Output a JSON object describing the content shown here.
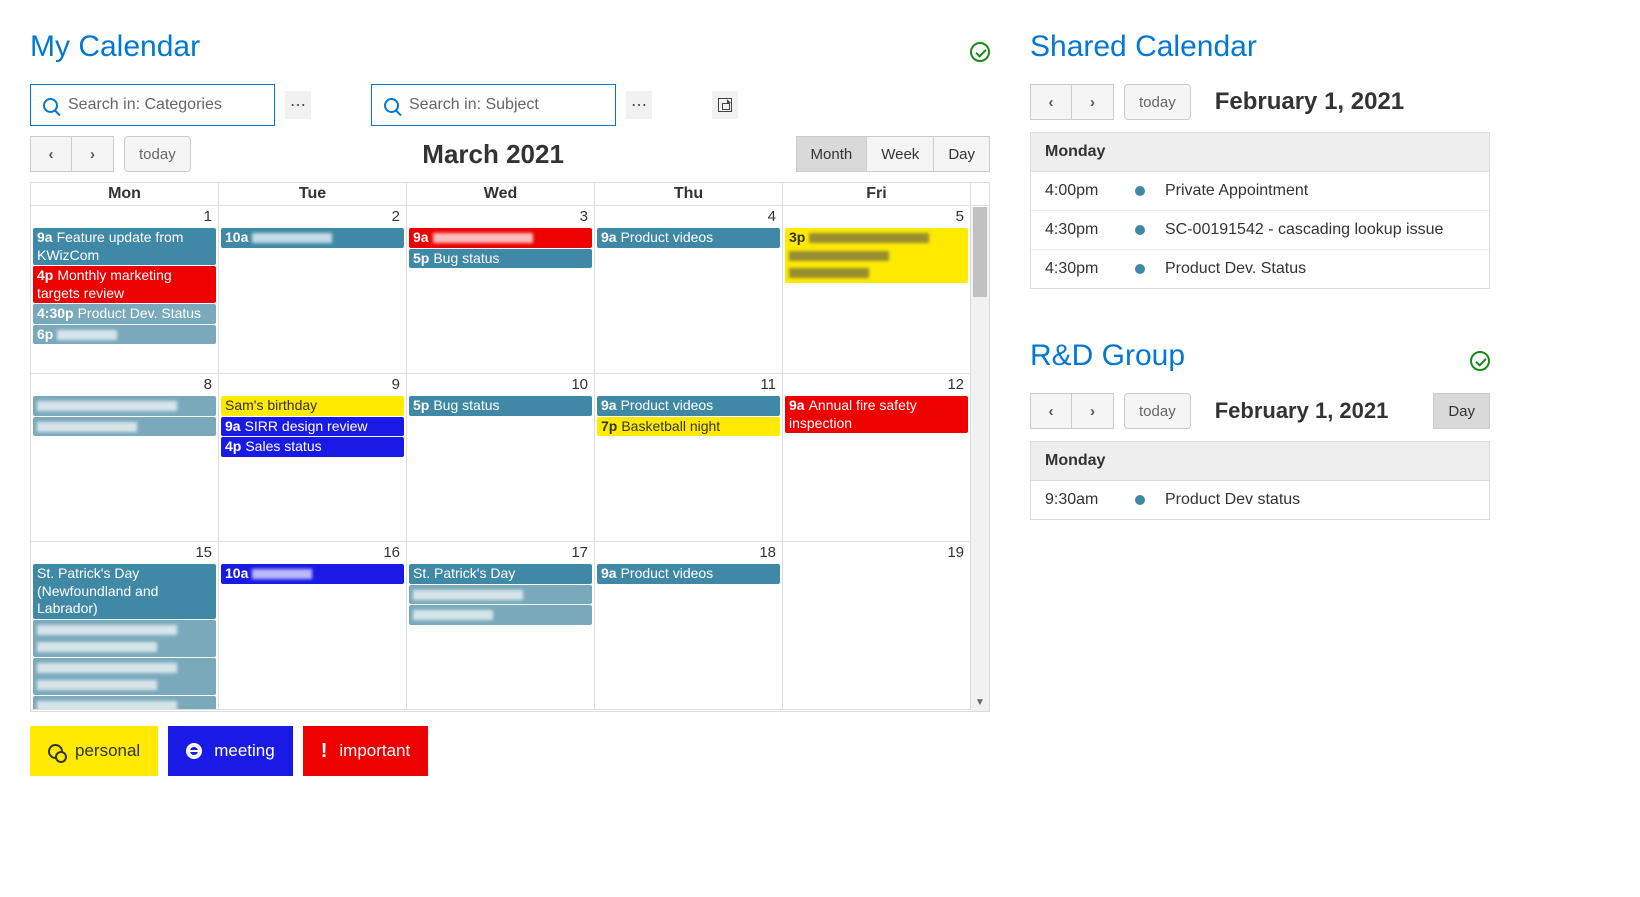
{
  "left": {
    "title": "My Calendar",
    "search": {
      "categories_placeholder": "Search in: Categories",
      "subject_placeholder": "Search in: Subject"
    },
    "nav": {
      "today": "today",
      "month_label": "March 2021"
    },
    "views": {
      "month": "Month",
      "week": "Week",
      "day": "Day"
    },
    "day_headers": [
      "Mon",
      "Tue",
      "Wed",
      "Thu",
      "Fri"
    ],
    "weeks": [
      {
        "days": [
          {
            "num": "1",
            "events": [
              {
                "color": "teal",
                "time": "9a",
                "title": "Feature update from KWizCom"
              },
              {
                "color": "red",
                "time": "4p",
                "title": "Monthly marketing targets review"
              },
              {
                "color": "teal",
                "time": "4:30p",
                "title": "Product Dev. Status",
                "faded": true
              },
              {
                "color": "teal",
                "time": "6p",
                "title": "",
                "blur": 60,
                "faded": true
              }
            ]
          },
          {
            "num": "2",
            "events": [
              {
                "color": "teal",
                "time": "10a",
                "title": "",
                "blur": 80
              }
            ]
          },
          {
            "num": "3",
            "events": [
              {
                "color": "red",
                "time": "9a",
                "title": "",
                "blur": 100
              },
              {
                "color": "teal",
                "time": "5p",
                "title": "Bug status"
              }
            ]
          },
          {
            "num": "4",
            "events": [
              {
                "color": "teal",
                "time": "9a",
                "title": "Product videos"
              }
            ]
          },
          {
            "num": "5",
            "events": [
              {
                "color": "yellow",
                "time": "3p",
                "title": "",
                "blur": 120,
                "lines": 3
              }
            ]
          }
        ]
      },
      {
        "days": [
          {
            "num": "8",
            "events": [
              {
                "color": "teal",
                "time": "",
                "title": "",
                "blur": 140,
                "faded": true
              },
              {
                "color": "teal",
                "time": "",
                "title": "",
                "blur": 100,
                "faded": true
              }
            ]
          },
          {
            "num": "9",
            "events": [
              {
                "color": "yellow",
                "time": "",
                "title": "Sam's birthday"
              },
              {
                "color": "blue",
                "time": "9a",
                "title": "SIRR design review"
              },
              {
                "color": "blue",
                "time": "4p",
                "title": "Sales status"
              }
            ]
          },
          {
            "num": "10",
            "events": [
              {
                "color": "teal",
                "time": "5p",
                "title": "Bug status"
              }
            ]
          },
          {
            "num": "11",
            "events": [
              {
                "color": "teal",
                "time": "9a",
                "title": "Product videos"
              },
              {
                "color": "yellow",
                "time": "7p",
                "title": "Basketball night"
              }
            ]
          },
          {
            "num": "12",
            "events": [
              {
                "color": "red",
                "time": "9a",
                "title": "Annual fire safety inspection"
              }
            ]
          }
        ]
      },
      {
        "days": [
          {
            "num": "15",
            "events": [
              {
                "color": "teal",
                "time": "",
                "title": "St. Patrick's Day (Newfoundland and Labrador)"
              },
              {
                "color": "teal",
                "time": "",
                "title": "",
                "blur": 140,
                "faded": true,
                "lines": 2
              },
              {
                "color": "teal",
                "time": "",
                "title": "",
                "blur": 140,
                "faded": true,
                "lines": 2
              },
              {
                "color": "teal",
                "time": "",
                "title": "",
                "blur": 140,
                "faded": true,
                "lines": 2
              }
            ]
          },
          {
            "num": "16",
            "events": [
              {
                "color": "blue",
                "time": "10a",
                "title": "",
                "blur": 60
              }
            ]
          },
          {
            "num": "17",
            "events": [
              {
                "color": "teal",
                "time": "",
                "title": "St. Patrick's Day"
              },
              {
                "color": "teal",
                "time": "",
                "title": "",
                "blur": 110,
                "faded": true
              },
              {
                "color": "teal",
                "time": "",
                "title": "",
                "blur": 80,
                "faded": true
              }
            ]
          },
          {
            "num": "18",
            "events": [
              {
                "color": "teal",
                "time": "9a",
                "title": "Product videos"
              }
            ]
          },
          {
            "num": "19",
            "events": []
          }
        ]
      }
    ],
    "legend": {
      "personal": "personal",
      "meeting": "meeting",
      "important": "important"
    }
  },
  "shared": {
    "title": "Shared Calendar",
    "nav": {
      "today": "today",
      "date_label": "February 1, 2021"
    },
    "day_label": "Monday",
    "items": [
      {
        "time": "4:00pm",
        "title": "Private Appointment"
      },
      {
        "time": "4:30pm",
        "title": "SC-00191542 - cascading lookup issue"
      },
      {
        "time": "4:30pm",
        "title": "Product Dev. Status"
      }
    ]
  },
  "rnd": {
    "title": "R&D Group",
    "nav": {
      "today": "today",
      "date_label": "February 1, 2021",
      "day": "Day"
    },
    "day_label": "Monday",
    "items": [
      {
        "time": "9:30am",
        "title": "Product Dev status"
      }
    ]
  }
}
